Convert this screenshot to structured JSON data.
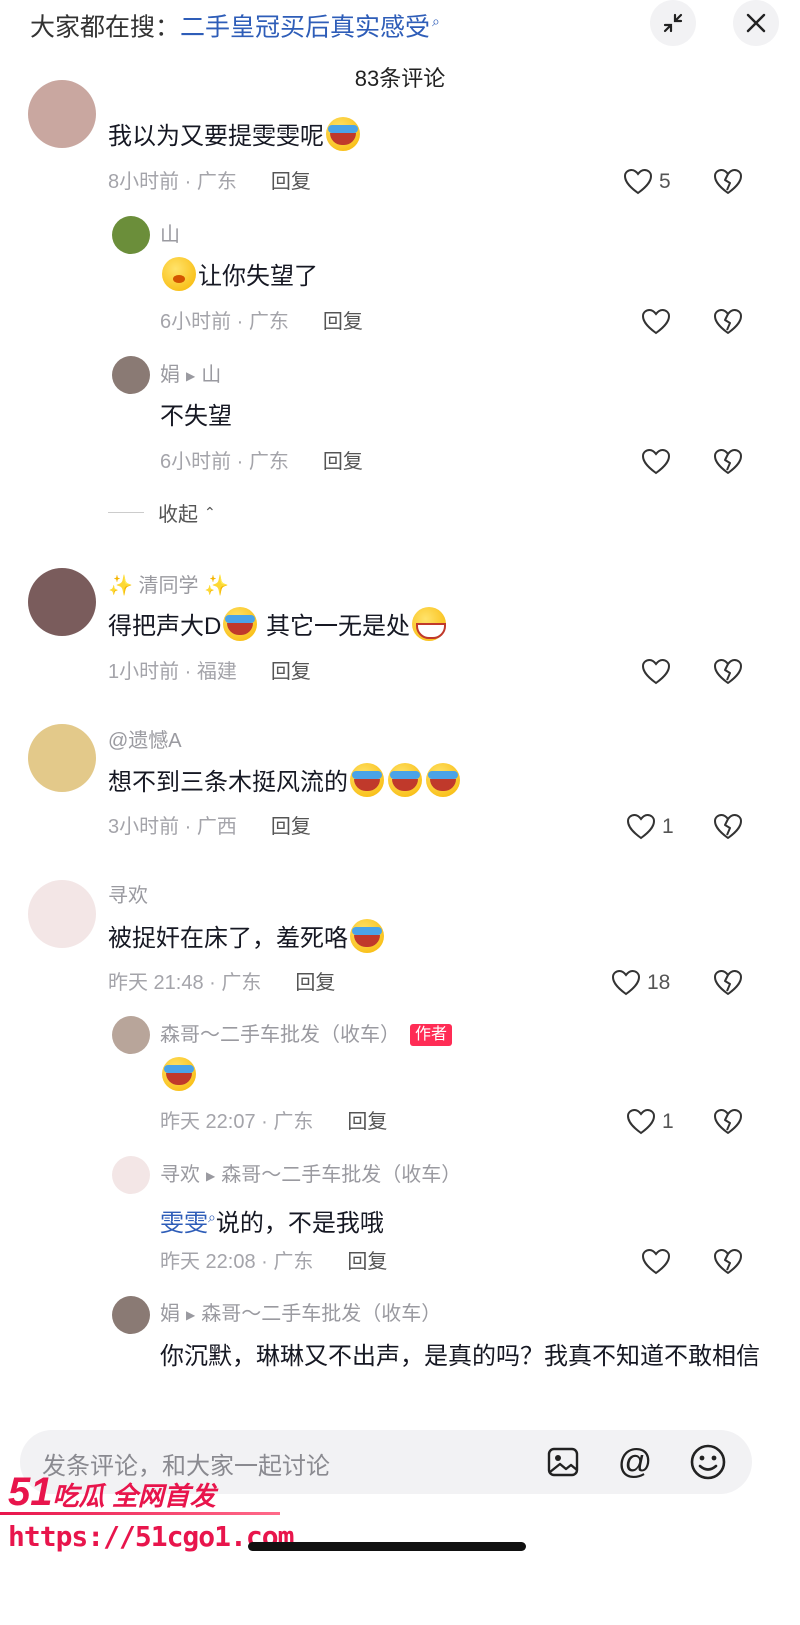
{
  "header": {
    "search_prefix": "大家都在搜：",
    "search_keyword": "二手皇冠买后真实感受",
    "comment_count": "83条评论"
  },
  "comments": [
    {
      "text": "我以为又要提雯雯呢",
      "time": "8小时前 · 广东",
      "reply": "回复",
      "likes": "5",
      "emojis": [
        "cry"
      ]
    },
    {
      "name": "山",
      "text": "让你失望了",
      "time": "6小时前 · 广东",
      "reply": "回复",
      "likes": "",
      "emojis": [
        "shy"
      ]
    },
    {
      "name": "娟",
      "reply_to": "山",
      "text": "不失望",
      "time": "6小时前 · 广东",
      "reply": "回复",
      "likes": ""
    },
    {
      "name": "✨ 清同学 ✨",
      "text_a": "得把声大D",
      "text_b": " 其它一无是处",
      "time": "1小时前 · 福建",
      "reply": "回复",
      "likes": "",
      "emojis": [
        "cry",
        "grin"
      ]
    },
    {
      "name": "@遗憾A",
      "text": "想不到三条木挺风流的",
      "time": "3小时前 · 广西",
      "reply": "回复",
      "likes": "1",
      "emojis": [
        "cry",
        "cry",
        "cry"
      ]
    },
    {
      "name": "寻欢",
      "text": "被捉奸在床了，羞死咯",
      "time": "昨天 21:48 · 广东",
      "reply": "回复",
      "likes": "18",
      "emojis": [
        "cry"
      ]
    },
    {
      "name": "森哥～二手车批发（收车）",
      "badge": "作者",
      "time": "昨天 22:07 · 广东",
      "reply": "回复",
      "likes": "1",
      "emojis": [
        "cry"
      ]
    },
    {
      "name": "寻欢",
      "reply_to": "森哥～二手车批发（收车）",
      "mention": "雯雯",
      "text": "说的，不是我哦",
      "time": "昨天 22:08 · 广东",
      "reply": "回复",
      "likes": ""
    },
    {
      "name": "娟",
      "reply_to": "森哥～二手车批发（收车）",
      "text": "你沉默，琳琳又不出声，是真的吗？我真不知道不敢相信"
    }
  ],
  "fold_label": "收起",
  "input": {
    "placeholder": "发条评论，和大家一起讨论"
  },
  "watermark": {
    "logo_number": "51",
    "logo_text": "吃瓜 全网首发",
    "url": "https://51cgo1.com"
  },
  "icons": {
    "collapse": "collapse-icon",
    "close": "close-icon",
    "like": "heart-outline-icon",
    "dislike": "broken-heart-icon",
    "image": "image-icon",
    "at": "at-icon",
    "emoji": "smiley-icon"
  },
  "colors": {
    "accent_link": "#2e5db8",
    "author_badge": "#ff2c55",
    "watermark": "#e8154c"
  }
}
